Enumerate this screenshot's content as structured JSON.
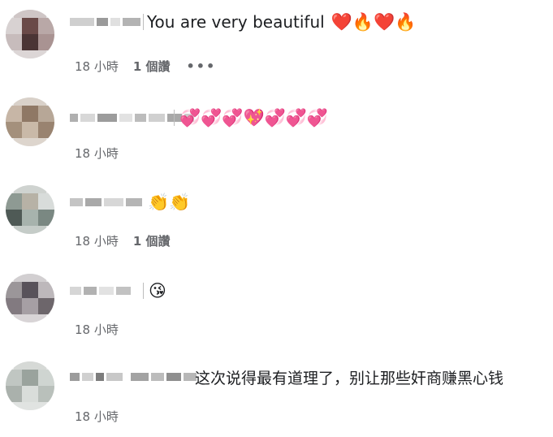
{
  "comments": [
    {
      "text": "You are very beautiful",
      "emojis": "❤️🔥❤️🔥",
      "time": "18 小時",
      "replies": "1 個讚",
      "more": "•••"
    },
    {
      "text": "",
      "emojis": "💞💞💞💖💞💞💞",
      "time": "18 小時"
    },
    {
      "text": "",
      "emojis": "👏👏",
      "time": "18 小時",
      "replies": "1 個讚"
    },
    {
      "text": "",
      "emojis": "😘",
      "time": "18 小時"
    },
    {
      "text": "这次说得最有道理了，别让那些奸商赚黑心钱",
      "emojis": "",
      "time": "18 小時"
    }
  ]
}
